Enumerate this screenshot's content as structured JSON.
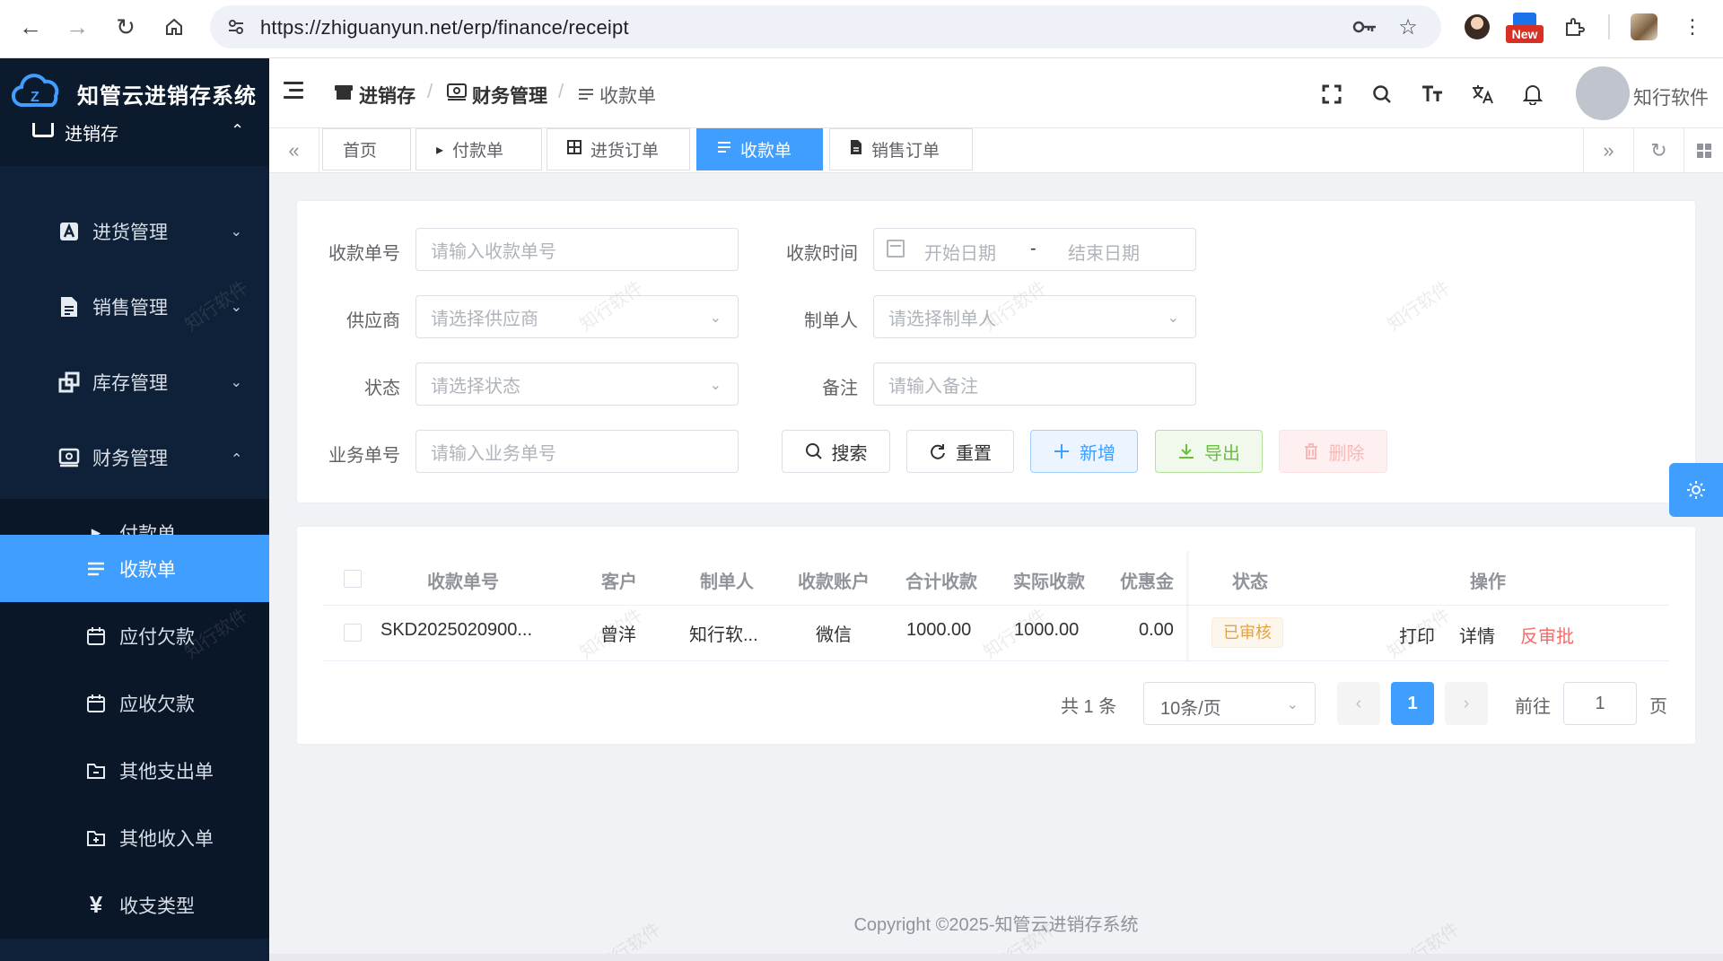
{
  "browser": {
    "url": "https://zhiguanyun.net/erp/finance/receipt",
    "ext_new_label": "New"
  },
  "app": {
    "logo_text": "知管云进销存系统",
    "user_name": "知行软件",
    "copyright": "Copyright ©2025-知管云进销存系统",
    "accent_color": "#409eff"
  },
  "sidebar": {
    "partial_top": "进销存",
    "items": [
      {
        "label": "进货管理",
        "icon": "letter-a-icon"
      },
      {
        "label": "销售管理",
        "icon": "document-icon"
      },
      {
        "label": "库存管理",
        "icon": "copy-icon"
      },
      {
        "label": "财务管理",
        "icon": "wallet-icon"
      }
    ],
    "sub_items": [
      {
        "label": "付款单",
        "icon": "caret-right-icon"
      },
      {
        "label": "收款单",
        "icon": "list-icon",
        "active": true
      },
      {
        "label": "应付欠款",
        "icon": "calendar-icon"
      },
      {
        "label": "应收欠款",
        "icon": "calendar-icon"
      },
      {
        "label": "其他支出单",
        "icon": "folder-minus-icon"
      },
      {
        "label": "其他收入单",
        "icon": "folder-plus-icon"
      },
      {
        "label": "收支类型",
        "icon": "yen-icon"
      }
    ]
  },
  "breadcrumb": {
    "items": [
      "进销存",
      "财务管理",
      "收款单"
    ],
    "separator": "/"
  },
  "tabs": [
    {
      "label": "首页"
    },
    {
      "label": "付款单"
    },
    {
      "label": "进货订单"
    },
    {
      "label": "收款单",
      "active": true
    },
    {
      "label": "销售订单"
    }
  ],
  "search_form": {
    "receipt_no": {
      "label": "收款单号",
      "placeholder": "请输入收款单号"
    },
    "receipt_time": {
      "label": "收款时间",
      "start_placeholder": "开始日期",
      "separator": "-",
      "end_placeholder": "结束日期"
    },
    "supplier": {
      "label": "供应商",
      "placeholder": "请选择供应商"
    },
    "creator": {
      "label": "制单人",
      "placeholder": "请选择制单人"
    },
    "status": {
      "label": "状态",
      "placeholder": "请选择状态"
    },
    "remark": {
      "label": "备注",
      "placeholder": "请输入备注"
    },
    "business_no": {
      "label": "业务单号",
      "placeholder": "请输入业务单号"
    },
    "buttons": {
      "search": "搜索",
      "reset": "重置",
      "add": "新增",
      "export": "导出",
      "delete": "删除"
    }
  },
  "watermark_text": "知行软件",
  "table": {
    "columns": [
      "收款单号",
      "客户",
      "制单人",
      "收款账户",
      "合计收款",
      "实际收款",
      "优惠金额",
      "状态",
      "操作"
    ],
    "rows": [
      {
        "receipt_no": "SKD2025020900...",
        "customer": "曾洋",
        "creator": "知行软...",
        "account": "微信",
        "total": "1000.00",
        "actual": "1000.00",
        "discount": "0.00",
        "status": "已审核",
        "actions": [
          "打印",
          "详情",
          "反审批"
        ]
      }
    ]
  },
  "pagination": {
    "total_text": "共 1 条",
    "page_size": "10条/页",
    "current_page": "1",
    "goto_label": "前往",
    "goto_value": "1",
    "page_unit": "页"
  }
}
